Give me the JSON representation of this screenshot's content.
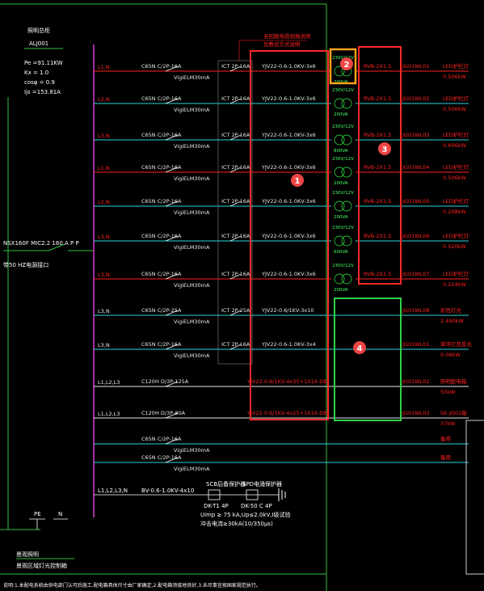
{
  "panel": {
    "title": "照明总柜",
    "code": "ALJ001",
    "params": [
      "Pe =91.11KW",
      "Kx = 1.0",
      "cosφ = 0.9",
      "Ijs =153.81A"
    ],
    "main_breaker": "NSX160F MIC2.2 160 A P P",
    "main_note": "带50 HZ电源接口",
    "header_note_top": "各回路电缆规格说明",
    "header_note_bottom": "及敷设方式说明"
  },
  "circuits": [
    {
      "phase": "L1,N",
      "breaker": "C65N C/2P-16A",
      "rcd": "VigiELM30mA",
      "contactor": "ICT 2P 16A",
      "cable": "YJV22-0.6-1.0KV-3x6",
      "lamp_top": "230V/12V",
      "lamp_bottom": "200VA",
      "wire": "RVB-2X1.5",
      "loop": "JG01WL01",
      "load": "LED护栏灯",
      "power": "0.506kW"
    },
    {
      "phase": "L2,N",
      "breaker": "C65N C/2P-16A",
      "rcd": "VigiELM30mA",
      "contactor": "ICT 2P 16A",
      "cable": "YJV22-0.6-1.0KV-3x6",
      "lamp_top": "230V/12V",
      "lamp_bottom": "200VA",
      "wire": "RVB-2X1.5",
      "loop": "JG01WL02",
      "load": "LED护栏灯",
      "power": "0.506kW"
    },
    {
      "phase": "L3,N",
      "breaker": "C65N C/2P-16A",
      "rcd": "VigiELM30mA",
      "contactor": "ICT 2P 16A",
      "cable": "YJV22-0.6-1.0KV-3x6",
      "lamp_top": "230V/12V",
      "lamp_bottom": "800VA",
      "wire": "RVB-2X1.5",
      "loop": "JG01WL03",
      "load": "LED护栏灯",
      "power": "0.606kW"
    },
    {
      "phase": "L1,N",
      "breaker": "C65N C/2P-16A",
      "rcd": "VigiELM30mA",
      "contactor": "ICT 2P 16A",
      "cable": "YJV22-0.6-1.0KV-3x6",
      "lamp_top": "230V/12V",
      "lamp_bottom": "200VA",
      "wire": "RVB-2X1.5",
      "loop": "JG01WL04",
      "load": "LED护栏灯",
      "power": "0.506kW"
    },
    {
      "phase": "L2,N",
      "breaker": "C65N C/2P-16A",
      "rcd": "VigiELM30mA",
      "contactor": "ICT 2P 16A",
      "cable": "YJV22-0.6-1.0KV-3x6",
      "lamp_top": "230V/12V",
      "lamp_bottom": "200VA",
      "wire": "RVB-2X1.5",
      "loop": "JG01WL05",
      "load": "LED护栏灯",
      "power": "0.208kW"
    },
    {
      "phase": "L3,N",
      "breaker": "C65N C/2P-16A",
      "rcd": "VigiELM30mA",
      "contactor": "ICT 2P 16A",
      "cable": "YJV22-0.6-1.0KV-3x6",
      "lamp_top": "230V/12V",
      "lamp_bottom": "600VA",
      "wire": "RVB-2X1.5",
      "loop": "JG01WL06",
      "load": "LED护栏灯",
      "power": "0.520kW"
    },
    {
      "phase": "L3,N",
      "breaker": "C65N C/2P-16A",
      "rcd": "VigiELM30mA",
      "contactor": "ICT 2P 16A",
      "cable": "YJV22-0.6-1.0KV-3x6",
      "lamp_top": "230V/12V",
      "lamp_bottom": "200VA",
      "wire": "RVB-2X1.5",
      "loop": "JG01WL07",
      "load": "LED护栏灯",
      "power": "0.224kW"
    }
  ],
  "extra_circuits": [
    {
      "phase": "L3,N",
      "breaker": "C65N C/2P-25A",
      "rcd": "VigiELM30mA",
      "contactor": "ICT 2P 25A",
      "cable": "YJV22-0.6/1KV-3x10",
      "loop": "JG01WL08",
      "load": "彩色灯光",
      "power": "2.490kW"
    },
    {
      "phase": "L3,N",
      "breaker": "C65N C/2P-16A",
      "rcd": "VigiELM30mA",
      "contactor": "ICT 2P 16A",
      "cable": "YJV22-0.6-1.0KV-3x4",
      "loop": "JG01WL01",
      "load": "草坪灯及投光",
      "power": "0.06kW"
    },
    {
      "phase": "L1,L2,L3",
      "breaker": "C120H D/3P-125A",
      "cable": "YJV22-0.6/1KV-4x35+1X16-DB",
      "loop": "JG01WL02",
      "load": "照明配电箱",
      "power": "50kW"
    },
    {
      "phase": "L1,L2,L3",
      "breaker": "C120H D/3P-80A",
      "cable": "YJV22-0.6/1KV-4x25+1X16-DB",
      "loop": "JG01WL03",
      "load": "SE-JG01箱",
      "power": "37kW"
    }
  ],
  "spares": [
    {
      "breaker": "C65N C/2P-16A",
      "rcd": "VigiELM30mA",
      "load": "备用"
    },
    {
      "breaker": "C65N C/2P-16A",
      "rcd": "VigiELM30mA",
      "load": "备用"
    }
  ],
  "spd": {
    "phase": "L1,L2,L3,N",
    "cable": "BV-0.6-1.0KV-4x10",
    "scb_label": "SCB后备保护器",
    "spd_label": "SPD电涌保护器",
    "scb_model": "DK-T1 4P",
    "spd_model": "DK-50 C 4P",
    "spec_line1": "Uimp ≥ 75 kA,Up≤2.0kV,I级试验",
    "spec_line2": "冲击电流≥30kA(10/350μs)"
  },
  "bus_labels": {
    "pe": "PE",
    "n": "N"
  },
  "footer": {
    "title": "景观照明",
    "subtitle": "景观区域灯光控制箱",
    "note": "说明:1.本配电系统由供电部门认可后施工,配电箱具体尺寸由厂家确定,2.配电箱须接地良好,3.未尽事宜按国家规范执行。"
  },
  "markers": [
    "1",
    "2",
    "3",
    "4"
  ],
  "colors": {
    "background": "#000000",
    "frame_green": "#2fbf3a",
    "feeder_red": "#ff2020",
    "feeder_cyan": "#2ad4dc",
    "bus_magenta": "#d040d0",
    "highlight_red": "#ff2a2a",
    "highlight_orange": "#ffa21a",
    "highlight_green": "#2fd14a",
    "marker_fill": "#ee4444"
  }
}
